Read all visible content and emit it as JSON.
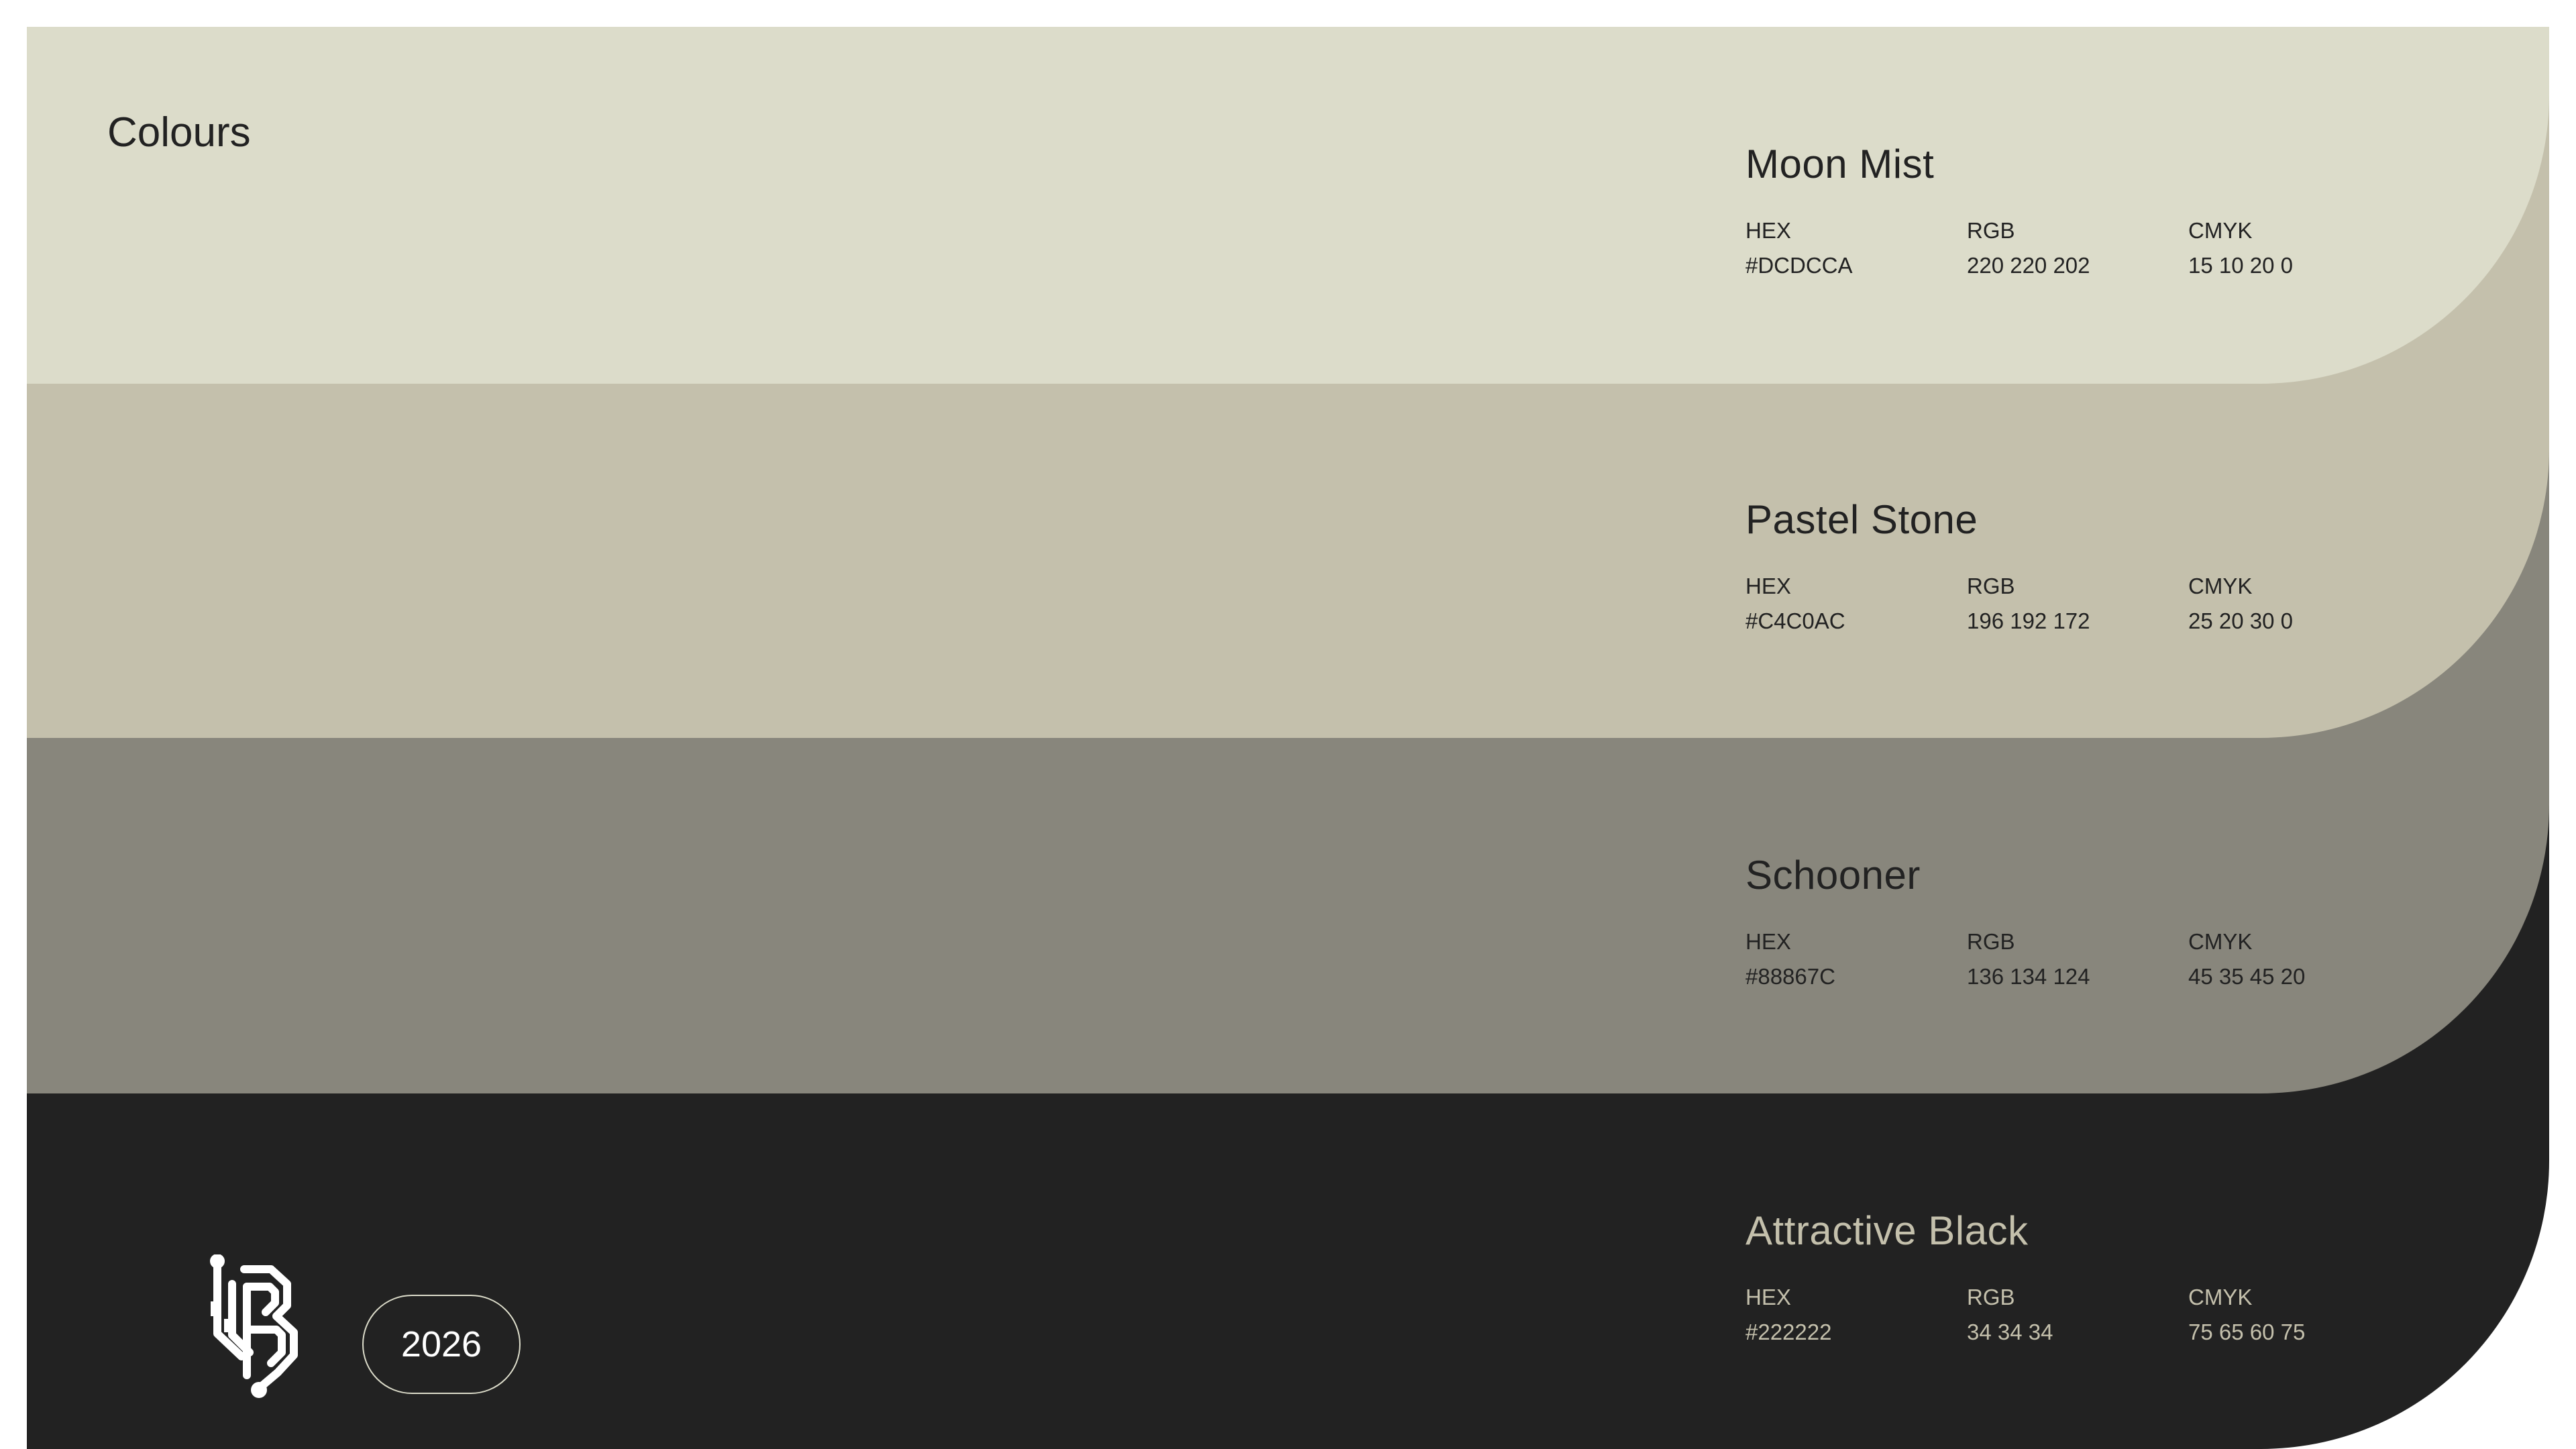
{
  "page": {
    "title": "Colours",
    "year": "2026",
    "logo": "bg-monogram-logo"
  },
  "swatches": [
    {
      "name": "Moon Mist",
      "color": "#DCDCCA",
      "hex_label": "HEX",
      "rgb_label": "RGB",
      "cmyk_label": "CMYK",
      "hex": "#DCDCCA",
      "rgb": "220 220 202",
      "cmyk": "15 10 20 0"
    },
    {
      "name": "Pastel Stone",
      "color": "#C4C0AC",
      "hex_label": "HEX",
      "rgb_label": "RGB",
      "cmyk_label": "CMYK",
      "hex": "#C4C0AC",
      "rgb": "196 192 172",
      "cmyk": "25 20 30 0"
    },
    {
      "name": "Schooner",
      "color": "#88867C",
      "hex_label": "HEX",
      "rgb_label": "RGB",
      "cmyk_label": "CMYK",
      "hex": "#88867C",
      "rgb": "136 134 124",
      "cmyk": "45 35 45 20"
    },
    {
      "name": "Attractive Black",
      "color": "#222222",
      "hex_label": "HEX",
      "rgb_label": "RGB",
      "cmyk_label": "CMYK",
      "hex": "#222222",
      "rgb": "34 34 34",
      "cmyk": "75 65 60 75"
    }
  ]
}
